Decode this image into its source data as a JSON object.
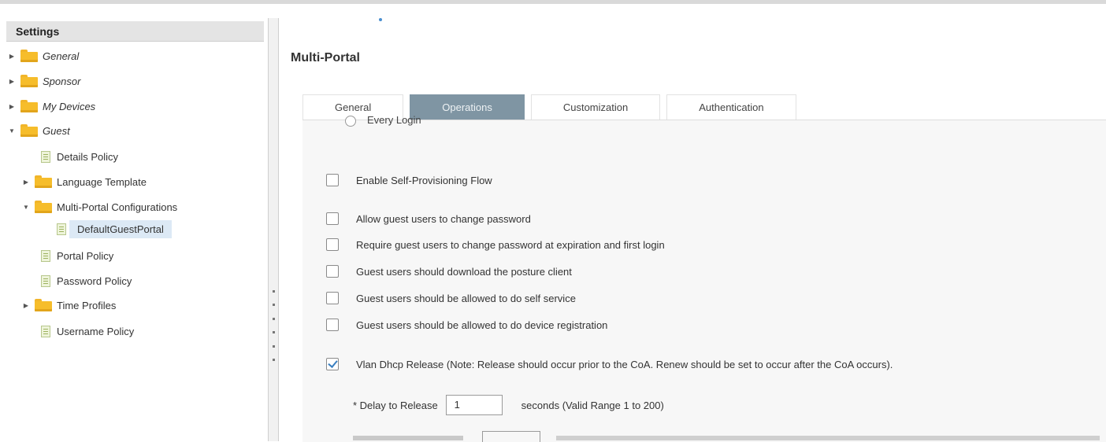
{
  "sidebar": {
    "title": "Settings",
    "tree": [
      {
        "label": "General",
        "kind": "folder",
        "expander": "collapsed",
        "italic": true
      },
      {
        "label": "Sponsor",
        "kind": "folder",
        "expander": "collapsed",
        "italic": true
      },
      {
        "label": "My Devices",
        "kind": "folder",
        "expander": "collapsed",
        "italic": true
      },
      {
        "label": "Guest",
        "kind": "folder",
        "expander": "expanded",
        "italic": true
      },
      {
        "label": "Details Policy",
        "kind": "policy"
      },
      {
        "label": "Language Template",
        "kind": "folder",
        "expander": "collapsed"
      },
      {
        "label": "Multi-Portal Configurations",
        "kind": "folder",
        "expander": "expanded"
      },
      {
        "label": "DefaultGuestPortal",
        "kind": "policy",
        "selected": true
      },
      {
        "label": "Portal Policy",
        "kind": "policy"
      },
      {
        "label": "Password Policy",
        "kind": "policy"
      },
      {
        "label": "Time Profiles",
        "kind": "folder",
        "expander": "collapsed"
      },
      {
        "label": "Username Policy",
        "kind": "policy"
      }
    ]
  },
  "main": {
    "title": "Multi-Portal",
    "tabs": [
      {
        "label": "General",
        "active": false
      },
      {
        "label": "Operations",
        "active": true
      },
      {
        "label": "Customization",
        "active": false
      },
      {
        "label": "Authentication",
        "active": false
      }
    ],
    "radio_label": "Every Login",
    "options": [
      {
        "label": "Enable Self-Provisioning Flow",
        "checked": false
      },
      {
        "label": "Allow guest users to change password",
        "checked": false
      },
      {
        "label": "Require guest users to change password at expiration and first login",
        "checked": false
      },
      {
        "label": "Guest users should download the posture client",
        "checked": false
      },
      {
        "label": "Guest users should be allowed to do self service",
        "checked": false
      },
      {
        "label": "Guest users should be allowed to do device registration",
        "checked": false
      },
      {
        "label": "Vlan Dhcp Release (Note: Release should occur prior to the CoA. Renew should be set to occur after the CoA occurs).",
        "checked": true
      }
    ],
    "delay": {
      "label": "* Delay to Release",
      "value": "1",
      "suffix": "seconds (Valid Range 1 to 200)"
    }
  },
  "colors": {
    "active_tab": "#7f95a3",
    "folder": "#f6bd2b",
    "selected_row": "#dce9f5"
  }
}
